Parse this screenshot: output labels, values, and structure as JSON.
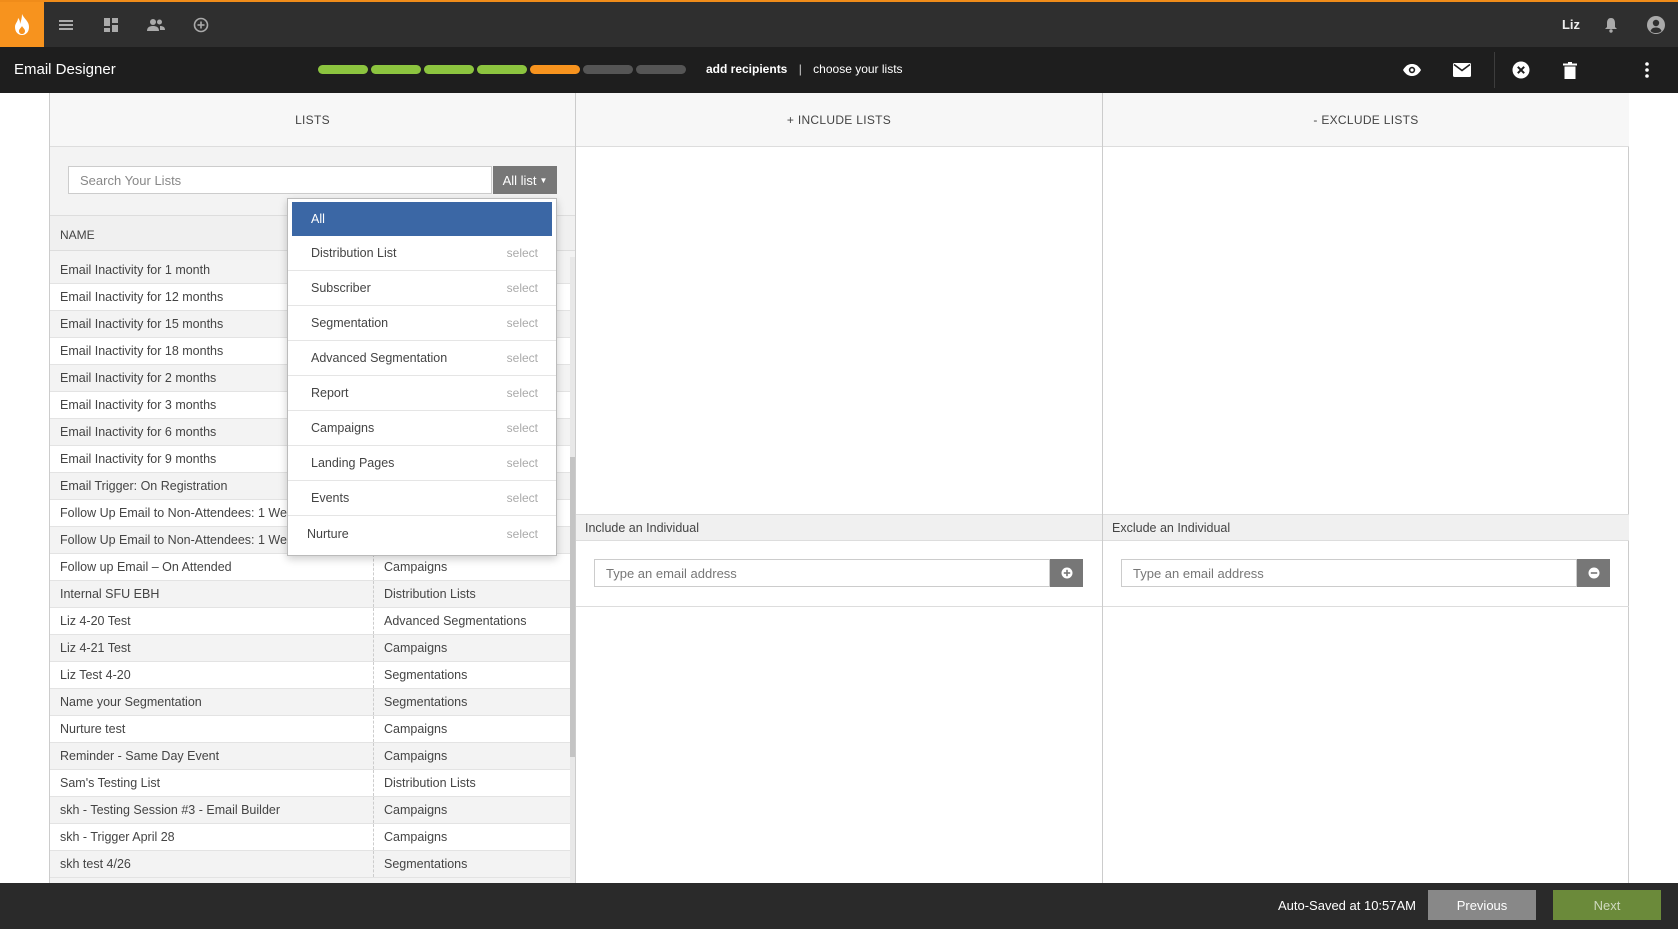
{
  "header": {
    "user_name": "Liz",
    "icons": [
      "flame-logo-icon",
      "menu-icon",
      "dashboard-icon",
      "contacts-icon",
      "add-circle-icon",
      "bell-icon",
      "account-icon"
    ]
  },
  "designer_bar": {
    "title": "Email Designer",
    "progress_colors": [
      "#8cc43f",
      "#8cc43f",
      "#8cc43f",
      "#8cc43f",
      "#f7931e",
      "#555555",
      "#555555"
    ],
    "step_label": "add recipients",
    "step_separator": "|",
    "sub_step_label": "choose your lists",
    "icons": [
      "eye-icon",
      "mail-icon",
      "close-circle-icon",
      "trash-icon",
      "more-vert-icon"
    ]
  },
  "lists_panel": {
    "header": "LISTS",
    "search_placeholder": "Search Your Lists",
    "filter_button": "All list",
    "column_name": "NAME",
    "rows": [
      {
        "name": "Email Inactivity for 1 month",
        "type": ""
      },
      {
        "name": "Email Inactivity for 12 months",
        "type": ""
      },
      {
        "name": "Email Inactivity for 15 months",
        "type": ""
      },
      {
        "name": "Email Inactivity for 18 months",
        "type": ""
      },
      {
        "name": "Email Inactivity for 2 months",
        "type": ""
      },
      {
        "name": "Email Inactivity for 3 months",
        "type": ""
      },
      {
        "name": "Email Inactivity for 6 months",
        "type": ""
      },
      {
        "name": "Email Inactivity for 9 months",
        "type": ""
      },
      {
        "name": "Email Trigger: On Registration",
        "type": ""
      },
      {
        "name": "Follow Up Email to Non-Attendees: 1 Week",
        "type": ""
      },
      {
        "name": "Follow Up Email to Non-Attendees: 1 Week",
        "type": ""
      },
      {
        "name": "Follow up Email – On Attended",
        "type": "Campaigns"
      },
      {
        "name": "Internal SFU EBH",
        "type": "Distribution Lists"
      },
      {
        "name": "Liz 4-20 Test",
        "type": "Advanced Segmentations"
      },
      {
        "name": "Liz 4-21 Test",
        "type": "Campaigns"
      },
      {
        "name": "Liz Test 4-20",
        "type": "Segmentations"
      },
      {
        "name": "Name your Segmentation",
        "type": "Segmentations"
      },
      {
        "name": "Nurture test",
        "type": "Campaigns"
      },
      {
        "name": "Reminder - Same Day Event",
        "type": "Campaigns"
      },
      {
        "name": "Sam's Testing List",
        "type": "Distribution Lists"
      },
      {
        "name": "skh - Testing Session #3 - Email Builder",
        "type": "Campaigns"
      },
      {
        "name": "skh - Trigger April 28",
        "type": "Campaigns"
      },
      {
        "name": "skh test 4/26",
        "type": "Segmentations"
      }
    ]
  },
  "dropdown": {
    "items": [
      {
        "label": "All",
        "action": ""
      },
      {
        "label": "Distribution List",
        "action": "select"
      },
      {
        "label": "Subscriber",
        "action": "select"
      },
      {
        "label": "Segmentation",
        "action": "select"
      },
      {
        "label": "Advanced Segmentation",
        "action": "select"
      },
      {
        "label": "Report",
        "action": "select"
      },
      {
        "label": "Campaigns",
        "action": "select"
      },
      {
        "label": "Landing Pages",
        "action": "select"
      },
      {
        "label": "Events",
        "action": "select"
      },
      {
        "label": "Nurture",
        "action": "select"
      }
    ]
  },
  "include_panel": {
    "header": "+ INCLUDE LISTS",
    "individual_label": "Include an Individual",
    "email_placeholder": "Type an email address"
  },
  "exclude_panel": {
    "header": "- EXCLUDE LISTS",
    "individual_label": "Exclude an Individual",
    "email_placeholder": "Type an email address"
  },
  "footer": {
    "autosave": "Auto-Saved at 10:57AM",
    "previous": "Previous",
    "next": "Next"
  }
}
